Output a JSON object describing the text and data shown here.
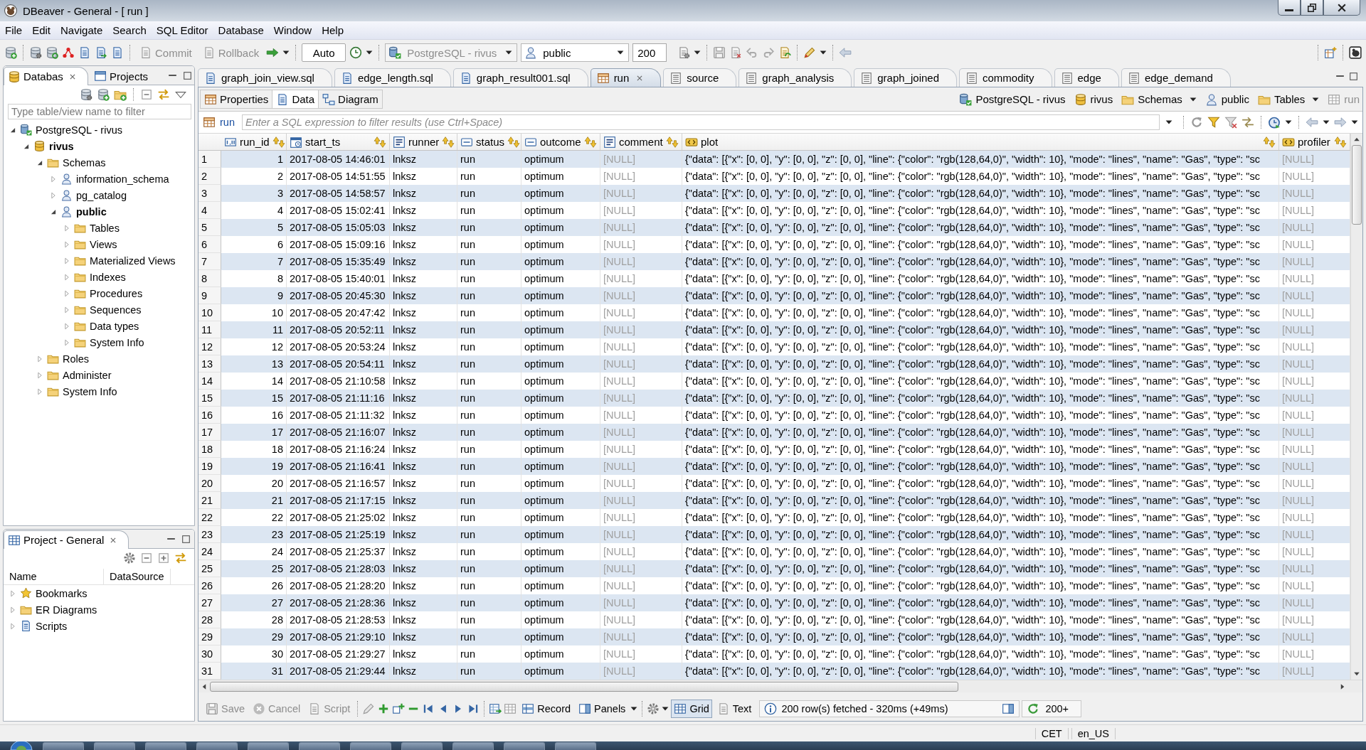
{
  "window": {
    "title": "DBeaver - General - [ run ]"
  },
  "menu": [
    "File",
    "Edit",
    "Navigate",
    "Search",
    "SQL Editor",
    "Database",
    "Window",
    "Help"
  ],
  "toolbar": {
    "transaction_buttons": [
      {
        "label": "Commit",
        "disabled": true
      },
      {
        "label": "Rollback",
        "disabled": true
      }
    ],
    "commit_mode": "Auto",
    "datasource": {
      "value": "PostgreSQL - rivus",
      "disabled": true
    },
    "schema": {
      "value": "public",
      "disabled": false
    },
    "result_limit": "200"
  },
  "navigator": {
    "tabs": [
      {
        "label": "Databas",
        "selected": true
      },
      {
        "label": "Projects",
        "selected": false
      }
    ],
    "filter": {
      "placeholder": "Type table/view name to filter"
    },
    "tree": [
      {
        "label": "PostgreSQL - rivus",
        "kind": "connection",
        "expanded": true,
        "bold": false,
        "children": [
          {
            "label": "rivus",
            "kind": "database",
            "expanded": true,
            "bold": true,
            "children": [
              {
                "label": "Schemas",
                "kind": "folder",
                "expanded": true,
                "bold": false,
                "children": [
                  {
                    "label": "information_schema",
                    "kind": "schema",
                    "expanded": false,
                    "bold": false
                  },
                  {
                    "label": "pg_catalog",
                    "kind": "schema",
                    "expanded": false,
                    "bold": false
                  },
                  {
                    "label": "public",
                    "kind": "schema",
                    "expanded": true,
                    "bold": true,
                    "children": [
                      {
                        "label": "Tables",
                        "kind": "folder",
                        "expanded": false,
                        "bold": false
                      },
                      {
                        "label": "Views",
                        "kind": "folder",
                        "expanded": false,
                        "bold": false
                      },
                      {
                        "label": "Materialized Views",
                        "kind": "folder",
                        "expanded": false,
                        "bold": false
                      },
                      {
                        "label": "Indexes",
                        "kind": "folder",
                        "expanded": false,
                        "bold": false
                      },
                      {
                        "label": "Procedures",
                        "kind": "folder",
                        "expanded": false,
                        "bold": false
                      },
                      {
                        "label": "Sequences",
                        "kind": "folder",
                        "expanded": false,
                        "bold": false
                      },
                      {
                        "label": "Data types",
                        "kind": "folder",
                        "expanded": false,
                        "bold": false
                      },
                      {
                        "label": "System Info",
                        "kind": "folder",
                        "expanded": false,
                        "bold": false
                      }
                    ]
                  }
                ]
              },
              {
                "label": "Roles",
                "kind": "folder",
                "expanded": false,
                "bold": false
              },
              {
                "label": "Administer",
                "kind": "folder",
                "expanded": false,
                "bold": false
              },
              {
                "label": "System Info",
                "kind": "folder",
                "expanded": false,
                "bold": false
              }
            ]
          }
        ]
      }
    ]
  },
  "project_panel": {
    "title": "Project - General",
    "columns": [
      "Name",
      "DataSource"
    ],
    "items": [
      {
        "label": "Bookmarks",
        "kind": "bookmarks",
        "expanded": false
      },
      {
        "label": "ER Diagrams",
        "kind": "diagrams",
        "expanded": false
      },
      {
        "label": "Scripts",
        "kind": "scripts",
        "expanded": false
      }
    ]
  },
  "editor_tabs": [
    {
      "label": "graph_join_view.sql",
      "kind": "script",
      "selected": false
    },
    {
      "label": "edge_length.sql",
      "kind": "script",
      "selected": false
    },
    {
      "label": "graph_result001.sql",
      "kind": "script",
      "selected": false
    },
    {
      "label": "run",
      "kind": "table",
      "selected": true
    },
    {
      "label": "source",
      "kind": "view",
      "selected": false
    },
    {
      "label": "graph_analysis",
      "kind": "view",
      "selected": false
    },
    {
      "label": "graph_joined",
      "kind": "view",
      "selected": false
    },
    {
      "label": "commodity",
      "kind": "view",
      "selected": false
    },
    {
      "label": "edge",
      "kind": "view",
      "selected": false
    },
    {
      "label": "edge_demand",
      "kind": "view",
      "selected": false
    }
  ],
  "view_tabs": [
    {
      "label": "Properties",
      "selected": false
    },
    {
      "label": "Data",
      "selected": true
    },
    {
      "label": "Diagram",
      "selected": false
    }
  ],
  "breadcrumb": [
    {
      "label": "PostgreSQL - rivus",
      "kind": "connection",
      "dropdown": false,
      "disabled": false
    },
    {
      "label": "rivus",
      "kind": "database",
      "dropdown": false,
      "disabled": false
    },
    {
      "label": "Schemas",
      "kind": "folder",
      "dropdown": true,
      "disabled": false
    },
    {
      "label": "public",
      "kind": "schema",
      "dropdown": false,
      "disabled": false
    },
    {
      "label": "Tables",
      "kind": "folder",
      "dropdown": true,
      "disabled": false
    },
    {
      "label": "run",
      "kind": "table",
      "dropdown": false,
      "disabled": true
    }
  ],
  "filter_bar": {
    "table": "run",
    "placeholder": "Enter a SQL expression to filter results (use Ctrl+Space)"
  },
  "table": {
    "columns": [
      {
        "name": "run_id",
        "kind": "numeric"
      },
      {
        "name": "start_ts",
        "kind": "timestamp"
      },
      {
        "name": "runner",
        "kind": "text"
      },
      {
        "name": "status",
        "kind": "string"
      },
      {
        "name": "outcome",
        "kind": "string"
      },
      {
        "name": "comment",
        "kind": "text"
      },
      {
        "name": "plot",
        "kind": "json"
      },
      {
        "name": "profiler",
        "kind": "json"
      }
    ],
    "rows": [
      {
        "number": "1",
        "cells": [
          {
            "text": "1",
            "null": false
          },
          {
            "text": "2017-08-05 14:46:01",
            "null": false
          },
          {
            "text": "lnksz",
            "null": false
          },
          {
            "text": "run",
            "null": false
          },
          {
            "text": "optimum",
            "null": false
          },
          {
            "text": "[NULL]",
            "null": true
          },
          {
            "text": "{\"data\": [{\"x\": [0, 0], \"y\": [0, 0], \"z\": [0, 0], \"line\": {\"color\": \"rgb(128,64,0)\", \"width\": 10}, \"mode\": \"lines\", \"name\": \"Gas\", \"type\": \"sc",
            "null": false
          },
          {
            "text": "[NULL]",
            "null": true
          }
        ]
      },
      {
        "number": "2",
        "cells": [
          {
            "text": "2",
            "null": false
          },
          {
            "text": "2017-08-05 14:51:55",
            "null": false
          },
          {
            "text": "lnksz",
            "null": false
          },
          {
            "text": "run",
            "null": false
          },
          {
            "text": "optimum",
            "null": false
          },
          {
            "text": "[NULL]",
            "null": true
          },
          {
            "text": "{\"data\": [{\"x\": [0, 0], \"y\": [0, 0], \"z\": [0, 0], \"line\": {\"color\": \"rgb(128,64,0)\", \"width\": 10}, \"mode\": \"lines\", \"name\": \"Gas\", \"type\": \"sc",
            "null": false
          },
          {
            "text": "[NULL]",
            "null": true
          }
        ]
      },
      {
        "number": "3",
        "cells": [
          {
            "text": "3",
            "null": false
          },
          {
            "text": "2017-08-05 14:58:57",
            "null": false
          },
          {
            "text": "lnksz",
            "null": false
          },
          {
            "text": "run",
            "null": false
          },
          {
            "text": "optimum",
            "null": false
          },
          {
            "text": "[NULL]",
            "null": true
          },
          {
            "text": "{\"data\": [{\"x\": [0, 0], \"y\": [0, 0], \"z\": [0, 0], \"line\": {\"color\": \"rgb(128,64,0)\", \"width\": 10}, \"mode\": \"lines\", \"name\": \"Gas\", \"type\": \"sc",
            "null": false
          },
          {
            "text": "[NULL]",
            "null": true
          }
        ]
      },
      {
        "number": "4",
        "cells": [
          {
            "text": "4",
            "null": false
          },
          {
            "text": "2017-08-05 15:02:41",
            "null": false
          },
          {
            "text": "lnksz",
            "null": false
          },
          {
            "text": "run",
            "null": false
          },
          {
            "text": "optimum",
            "null": false
          },
          {
            "text": "[NULL]",
            "null": true
          },
          {
            "text": "{\"data\": [{\"x\": [0, 0], \"y\": [0, 0], \"z\": [0, 0], \"line\": {\"color\": \"rgb(128,64,0)\", \"width\": 10}, \"mode\": \"lines\", \"name\": \"Gas\", \"type\": \"sc",
            "null": false
          },
          {
            "text": "[NULL]",
            "null": true
          }
        ]
      },
      {
        "number": "5",
        "cells": [
          {
            "text": "5",
            "null": false
          },
          {
            "text": "2017-08-05 15:05:03",
            "null": false
          },
          {
            "text": "lnksz",
            "null": false
          },
          {
            "text": "run",
            "null": false
          },
          {
            "text": "optimum",
            "null": false
          },
          {
            "text": "[NULL]",
            "null": true
          },
          {
            "text": "{\"data\": [{\"x\": [0, 0], \"y\": [0, 0], \"z\": [0, 0], \"line\": {\"color\": \"rgb(128,64,0)\", \"width\": 10}, \"mode\": \"lines\", \"name\": \"Gas\", \"type\": \"sc",
            "null": false
          },
          {
            "text": "[NULL]",
            "null": true
          }
        ]
      },
      {
        "number": "6",
        "cells": [
          {
            "text": "6",
            "null": false
          },
          {
            "text": "2017-08-05 15:09:16",
            "null": false
          },
          {
            "text": "lnksz",
            "null": false
          },
          {
            "text": "run",
            "null": false
          },
          {
            "text": "optimum",
            "null": false
          },
          {
            "text": "[NULL]",
            "null": true
          },
          {
            "text": "{\"data\": [{\"x\": [0, 0], \"y\": [0, 0], \"z\": [0, 0], \"line\": {\"color\": \"rgb(128,64,0)\", \"width\": 10}, \"mode\": \"lines\", \"name\": \"Gas\", \"type\": \"sc",
            "null": false
          },
          {
            "text": "[NULL]",
            "null": true
          }
        ]
      },
      {
        "number": "7",
        "cells": [
          {
            "text": "7",
            "null": false
          },
          {
            "text": "2017-08-05 15:35:49",
            "null": false
          },
          {
            "text": "lnksz",
            "null": false
          },
          {
            "text": "run",
            "null": false
          },
          {
            "text": "optimum",
            "null": false
          },
          {
            "text": "[NULL]",
            "null": true
          },
          {
            "text": "{\"data\": [{\"x\": [0, 0], \"y\": [0, 0], \"z\": [0, 0], \"line\": {\"color\": \"rgb(128,64,0)\", \"width\": 10}, \"mode\": \"lines\", \"name\": \"Gas\", \"type\": \"sc",
            "null": false
          },
          {
            "text": "[NULL]",
            "null": true
          }
        ]
      },
      {
        "number": "8",
        "cells": [
          {
            "text": "8",
            "null": false
          },
          {
            "text": "2017-08-05 15:40:01",
            "null": false
          },
          {
            "text": "lnksz",
            "null": false
          },
          {
            "text": "run",
            "null": false
          },
          {
            "text": "optimum",
            "null": false
          },
          {
            "text": "[NULL]",
            "null": true
          },
          {
            "text": "{\"data\": [{\"x\": [0, 0], \"y\": [0, 0], \"z\": [0, 0], \"line\": {\"color\": \"rgb(128,64,0)\", \"width\": 10}, \"mode\": \"lines\", \"name\": \"Gas\", \"type\": \"sc",
            "null": false
          },
          {
            "text": "[NULL]",
            "null": true
          }
        ]
      },
      {
        "number": "9",
        "cells": [
          {
            "text": "9",
            "null": false
          },
          {
            "text": "2017-08-05 20:45:30",
            "null": false
          },
          {
            "text": "lnksz",
            "null": false
          },
          {
            "text": "run",
            "null": false
          },
          {
            "text": "optimum",
            "null": false
          },
          {
            "text": "[NULL]",
            "null": true
          },
          {
            "text": "{\"data\": [{\"x\": [0, 0], \"y\": [0, 0], \"z\": [0, 0], \"line\": {\"color\": \"rgb(128,64,0)\", \"width\": 10}, \"mode\": \"lines\", \"name\": \"Gas\", \"type\": \"sc",
            "null": false
          },
          {
            "text": "[NULL]",
            "null": true
          }
        ]
      },
      {
        "number": "10",
        "cells": [
          {
            "text": "10",
            "null": false
          },
          {
            "text": "2017-08-05 20:47:42",
            "null": false
          },
          {
            "text": "lnksz",
            "null": false
          },
          {
            "text": "run",
            "null": false
          },
          {
            "text": "optimum",
            "null": false
          },
          {
            "text": "[NULL]",
            "null": true
          },
          {
            "text": "{\"data\": [{\"x\": [0, 0], \"y\": [0, 0], \"z\": [0, 0], \"line\": {\"color\": \"rgb(128,64,0)\", \"width\": 10}, \"mode\": \"lines\", \"name\": \"Gas\", \"type\": \"sc",
            "null": false
          },
          {
            "text": "[NULL]",
            "null": true
          }
        ]
      },
      {
        "number": "11",
        "cells": [
          {
            "text": "11",
            "null": false
          },
          {
            "text": "2017-08-05 20:52:11",
            "null": false
          },
          {
            "text": "lnksz",
            "null": false
          },
          {
            "text": "run",
            "null": false
          },
          {
            "text": "optimum",
            "null": false
          },
          {
            "text": "[NULL]",
            "null": true
          },
          {
            "text": "{\"data\": [{\"x\": [0, 0], \"y\": [0, 0], \"z\": [0, 0], \"line\": {\"color\": \"rgb(128,64,0)\", \"width\": 10}, \"mode\": \"lines\", \"name\": \"Gas\", \"type\": \"sc",
            "null": false
          },
          {
            "text": "[NULL]",
            "null": true
          }
        ]
      },
      {
        "number": "12",
        "cells": [
          {
            "text": "12",
            "null": false
          },
          {
            "text": "2017-08-05 20:53:24",
            "null": false
          },
          {
            "text": "lnksz",
            "null": false
          },
          {
            "text": "run",
            "null": false
          },
          {
            "text": "optimum",
            "null": false
          },
          {
            "text": "[NULL]",
            "null": true
          },
          {
            "text": "{\"data\": [{\"x\": [0, 0], \"y\": [0, 0], \"z\": [0, 0], \"line\": {\"color\": \"rgb(128,64,0)\", \"width\": 10}, \"mode\": \"lines\", \"name\": \"Gas\", \"type\": \"sc",
            "null": false
          },
          {
            "text": "[NULL]",
            "null": true
          }
        ]
      },
      {
        "number": "13",
        "cells": [
          {
            "text": "13",
            "null": false
          },
          {
            "text": "2017-08-05 20:54:11",
            "null": false
          },
          {
            "text": "lnksz",
            "null": false
          },
          {
            "text": "run",
            "null": false
          },
          {
            "text": "optimum",
            "null": false
          },
          {
            "text": "[NULL]",
            "null": true
          },
          {
            "text": "{\"data\": [{\"x\": [0, 0], \"y\": [0, 0], \"z\": [0, 0], \"line\": {\"color\": \"rgb(128,64,0)\", \"width\": 10}, \"mode\": \"lines\", \"name\": \"Gas\", \"type\": \"sc",
            "null": false
          },
          {
            "text": "[NULL]",
            "null": true
          }
        ]
      },
      {
        "number": "14",
        "cells": [
          {
            "text": "14",
            "null": false
          },
          {
            "text": "2017-08-05 21:10:58",
            "null": false
          },
          {
            "text": "lnksz",
            "null": false
          },
          {
            "text": "run",
            "null": false
          },
          {
            "text": "optimum",
            "null": false
          },
          {
            "text": "[NULL]",
            "null": true
          },
          {
            "text": "{\"data\": [{\"x\": [0, 0], \"y\": [0, 0], \"z\": [0, 0], \"line\": {\"color\": \"rgb(128,64,0)\", \"width\": 10}, \"mode\": \"lines\", \"name\": \"Gas\", \"type\": \"sc",
            "null": false
          },
          {
            "text": "[NULL]",
            "null": true
          }
        ]
      },
      {
        "number": "15",
        "cells": [
          {
            "text": "15",
            "null": false
          },
          {
            "text": "2017-08-05 21:11:16",
            "null": false
          },
          {
            "text": "lnksz",
            "null": false
          },
          {
            "text": "run",
            "null": false
          },
          {
            "text": "optimum",
            "null": false
          },
          {
            "text": "[NULL]",
            "null": true
          },
          {
            "text": "{\"data\": [{\"x\": [0, 0], \"y\": [0, 0], \"z\": [0, 0], \"line\": {\"color\": \"rgb(128,64,0)\", \"width\": 10}, \"mode\": \"lines\", \"name\": \"Gas\", \"type\": \"sc",
            "null": false
          },
          {
            "text": "[NULL]",
            "null": true
          }
        ]
      },
      {
        "number": "16",
        "cells": [
          {
            "text": "16",
            "null": false
          },
          {
            "text": "2017-08-05 21:11:32",
            "null": false
          },
          {
            "text": "lnksz",
            "null": false
          },
          {
            "text": "run",
            "null": false
          },
          {
            "text": "optimum",
            "null": false
          },
          {
            "text": "[NULL]",
            "null": true
          },
          {
            "text": "{\"data\": [{\"x\": [0, 0], \"y\": [0, 0], \"z\": [0, 0], \"line\": {\"color\": \"rgb(128,64,0)\", \"width\": 10}, \"mode\": \"lines\", \"name\": \"Gas\", \"type\": \"sc",
            "null": false
          },
          {
            "text": "[NULL]",
            "null": true
          }
        ]
      },
      {
        "number": "17",
        "cells": [
          {
            "text": "17",
            "null": false
          },
          {
            "text": "2017-08-05 21:16:07",
            "null": false
          },
          {
            "text": "lnksz",
            "null": false
          },
          {
            "text": "run",
            "null": false
          },
          {
            "text": "optimum",
            "null": false
          },
          {
            "text": "[NULL]",
            "null": true
          },
          {
            "text": "{\"data\": [{\"x\": [0, 0], \"y\": [0, 0], \"z\": [0, 0], \"line\": {\"color\": \"rgb(128,64,0)\", \"width\": 10}, \"mode\": \"lines\", \"name\": \"Gas\", \"type\": \"sc",
            "null": false
          },
          {
            "text": "[NULL]",
            "null": true
          }
        ]
      },
      {
        "number": "18",
        "cells": [
          {
            "text": "18",
            "null": false
          },
          {
            "text": "2017-08-05 21:16:24",
            "null": false
          },
          {
            "text": "lnksz",
            "null": false
          },
          {
            "text": "run",
            "null": false
          },
          {
            "text": "optimum",
            "null": false
          },
          {
            "text": "[NULL]",
            "null": true
          },
          {
            "text": "{\"data\": [{\"x\": [0, 0], \"y\": [0, 0], \"z\": [0, 0], \"line\": {\"color\": \"rgb(128,64,0)\", \"width\": 10}, \"mode\": \"lines\", \"name\": \"Gas\", \"type\": \"sc",
            "null": false
          },
          {
            "text": "[NULL]",
            "null": true
          }
        ]
      },
      {
        "number": "19",
        "cells": [
          {
            "text": "19",
            "null": false
          },
          {
            "text": "2017-08-05 21:16:41",
            "null": false
          },
          {
            "text": "lnksz",
            "null": false
          },
          {
            "text": "run",
            "null": false
          },
          {
            "text": "optimum",
            "null": false
          },
          {
            "text": "[NULL]",
            "null": true
          },
          {
            "text": "{\"data\": [{\"x\": [0, 0], \"y\": [0, 0], \"z\": [0, 0], \"line\": {\"color\": \"rgb(128,64,0)\", \"width\": 10}, \"mode\": \"lines\", \"name\": \"Gas\", \"type\": \"sc",
            "null": false
          },
          {
            "text": "[NULL]",
            "null": true
          }
        ]
      },
      {
        "number": "20",
        "cells": [
          {
            "text": "20",
            "null": false
          },
          {
            "text": "2017-08-05 21:16:57",
            "null": false
          },
          {
            "text": "lnksz",
            "null": false
          },
          {
            "text": "run",
            "null": false
          },
          {
            "text": "optimum",
            "null": false
          },
          {
            "text": "[NULL]",
            "null": true
          },
          {
            "text": "{\"data\": [{\"x\": [0, 0], \"y\": [0, 0], \"z\": [0, 0], \"line\": {\"color\": \"rgb(128,64,0)\", \"width\": 10}, \"mode\": \"lines\", \"name\": \"Gas\", \"type\": \"sc",
            "null": false
          },
          {
            "text": "[NULL]",
            "null": true
          }
        ]
      },
      {
        "number": "21",
        "cells": [
          {
            "text": "21",
            "null": false
          },
          {
            "text": "2017-08-05 21:17:15",
            "null": false
          },
          {
            "text": "lnksz",
            "null": false
          },
          {
            "text": "run",
            "null": false
          },
          {
            "text": "optimum",
            "null": false
          },
          {
            "text": "[NULL]",
            "null": true
          },
          {
            "text": "{\"data\": [{\"x\": [0, 0], \"y\": [0, 0], \"z\": [0, 0], \"line\": {\"color\": \"rgb(128,64,0)\", \"width\": 10}, \"mode\": \"lines\", \"name\": \"Gas\", \"type\": \"sc",
            "null": false
          },
          {
            "text": "[NULL]",
            "null": true
          }
        ]
      },
      {
        "number": "22",
        "cells": [
          {
            "text": "22",
            "null": false
          },
          {
            "text": "2017-08-05 21:25:02",
            "null": false
          },
          {
            "text": "lnksz",
            "null": false
          },
          {
            "text": "run",
            "null": false
          },
          {
            "text": "optimum",
            "null": false
          },
          {
            "text": "[NULL]",
            "null": true
          },
          {
            "text": "{\"data\": [{\"x\": [0, 0], \"y\": [0, 0], \"z\": [0, 0], \"line\": {\"color\": \"rgb(128,64,0)\", \"width\": 10}, \"mode\": \"lines\", \"name\": \"Gas\", \"type\": \"sc",
            "null": false
          },
          {
            "text": "[NULL]",
            "null": true
          }
        ]
      },
      {
        "number": "23",
        "cells": [
          {
            "text": "23",
            "null": false
          },
          {
            "text": "2017-08-05 21:25:19",
            "null": false
          },
          {
            "text": "lnksz",
            "null": false
          },
          {
            "text": "run",
            "null": false
          },
          {
            "text": "optimum",
            "null": false
          },
          {
            "text": "[NULL]",
            "null": true
          },
          {
            "text": "{\"data\": [{\"x\": [0, 0], \"y\": [0, 0], \"z\": [0, 0], \"line\": {\"color\": \"rgb(128,64,0)\", \"width\": 10}, \"mode\": \"lines\", \"name\": \"Gas\", \"type\": \"sc",
            "null": false
          },
          {
            "text": "[NULL]",
            "null": true
          }
        ]
      },
      {
        "number": "24",
        "cells": [
          {
            "text": "24",
            "null": false
          },
          {
            "text": "2017-08-05 21:25:37",
            "null": false
          },
          {
            "text": "lnksz",
            "null": false
          },
          {
            "text": "run",
            "null": false
          },
          {
            "text": "optimum",
            "null": false
          },
          {
            "text": "[NULL]",
            "null": true
          },
          {
            "text": "{\"data\": [{\"x\": [0, 0], \"y\": [0, 0], \"z\": [0, 0], \"line\": {\"color\": \"rgb(128,64,0)\", \"width\": 10}, \"mode\": \"lines\", \"name\": \"Gas\", \"type\": \"sc",
            "null": false
          },
          {
            "text": "[NULL]",
            "null": true
          }
        ]
      },
      {
        "number": "25",
        "cells": [
          {
            "text": "25",
            "null": false
          },
          {
            "text": "2017-08-05 21:28:03",
            "null": false
          },
          {
            "text": "lnksz",
            "null": false
          },
          {
            "text": "run",
            "null": false
          },
          {
            "text": "optimum",
            "null": false
          },
          {
            "text": "[NULL]",
            "null": true
          },
          {
            "text": "{\"data\": [{\"x\": [0, 0], \"y\": [0, 0], \"z\": [0, 0], \"line\": {\"color\": \"rgb(128,64,0)\", \"width\": 10}, \"mode\": \"lines\", \"name\": \"Gas\", \"type\": \"sc",
            "null": false
          },
          {
            "text": "[NULL]",
            "null": true
          }
        ]
      },
      {
        "number": "26",
        "cells": [
          {
            "text": "26",
            "null": false
          },
          {
            "text": "2017-08-05 21:28:20",
            "null": false
          },
          {
            "text": "lnksz",
            "null": false
          },
          {
            "text": "run",
            "null": false
          },
          {
            "text": "optimum",
            "null": false
          },
          {
            "text": "[NULL]",
            "null": true
          },
          {
            "text": "{\"data\": [{\"x\": [0, 0], \"y\": [0, 0], \"z\": [0, 0], \"line\": {\"color\": \"rgb(128,64,0)\", \"width\": 10}, \"mode\": \"lines\", \"name\": \"Gas\", \"type\": \"sc",
            "null": false
          },
          {
            "text": "[NULL]",
            "null": true
          }
        ]
      },
      {
        "number": "27",
        "cells": [
          {
            "text": "27",
            "null": false
          },
          {
            "text": "2017-08-05 21:28:36",
            "null": false
          },
          {
            "text": "lnksz",
            "null": false
          },
          {
            "text": "run",
            "null": false
          },
          {
            "text": "optimum",
            "null": false
          },
          {
            "text": "[NULL]",
            "null": true
          },
          {
            "text": "{\"data\": [{\"x\": [0, 0], \"y\": [0, 0], \"z\": [0, 0], \"line\": {\"color\": \"rgb(128,64,0)\", \"width\": 10}, \"mode\": \"lines\", \"name\": \"Gas\", \"type\": \"sc",
            "null": false
          },
          {
            "text": "[NULL]",
            "null": true
          }
        ]
      },
      {
        "number": "28",
        "cells": [
          {
            "text": "28",
            "null": false
          },
          {
            "text": "2017-08-05 21:28:53",
            "null": false
          },
          {
            "text": "lnksz",
            "null": false
          },
          {
            "text": "run",
            "null": false
          },
          {
            "text": "optimum",
            "null": false
          },
          {
            "text": "[NULL]",
            "null": true
          },
          {
            "text": "{\"data\": [{\"x\": [0, 0], \"y\": [0, 0], \"z\": [0, 0], \"line\": {\"color\": \"rgb(128,64,0)\", \"width\": 10}, \"mode\": \"lines\", \"name\": \"Gas\", \"type\": \"sc",
            "null": false
          },
          {
            "text": "[NULL]",
            "null": true
          }
        ]
      },
      {
        "number": "29",
        "cells": [
          {
            "text": "29",
            "null": false
          },
          {
            "text": "2017-08-05 21:29:10",
            "null": false
          },
          {
            "text": "lnksz",
            "null": false
          },
          {
            "text": "run",
            "null": false
          },
          {
            "text": "optimum",
            "null": false
          },
          {
            "text": "[NULL]",
            "null": true
          },
          {
            "text": "{\"data\": [{\"x\": [0, 0], \"y\": [0, 0], \"z\": [0, 0], \"line\": {\"color\": \"rgb(128,64,0)\", \"width\": 10}, \"mode\": \"lines\", \"name\": \"Gas\", \"type\": \"sc",
            "null": false
          },
          {
            "text": "[NULL]",
            "null": true
          }
        ]
      },
      {
        "number": "30",
        "cells": [
          {
            "text": "30",
            "null": false
          },
          {
            "text": "2017-08-05 21:29:27",
            "null": false
          },
          {
            "text": "lnksz",
            "null": false
          },
          {
            "text": "run",
            "null": false
          },
          {
            "text": "optimum",
            "null": false
          },
          {
            "text": "[NULL]",
            "null": true
          },
          {
            "text": "{\"data\": [{\"x\": [0, 0], \"y\": [0, 0], \"z\": [0, 0], \"line\": {\"color\": \"rgb(128,64,0)\", \"width\": 10}, \"mode\": \"lines\", \"name\": \"Gas\", \"type\": \"sc",
            "null": false
          },
          {
            "text": "[NULL]",
            "null": true
          }
        ]
      },
      {
        "number": "31",
        "cells": [
          {
            "text": "31",
            "null": false
          },
          {
            "text": "2017-08-05 21:29:44",
            "null": false
          },
          {
            "text": "lnksz",
            "null": false
          },
          {
            "text": "run",
            "null": false
          },
          {
            "text": "optimum",
            "null": false
          },
          {
            "text": "[NULL]",
            "null": true
          },
          {
            "text": "{\"data\": [{\"x\": [0, 0], \"y\": [0, 0], \"z\": [0, 0], \"line\": {\"color\": \"rgb(128,64,0)\", \"width\": 10}, \"mode\": \"lines\", \"name\": \"Gas\", \"type\": \"sc",
            "null": false
          },
          {
            "text": "[NULL]",
            "null": true
          }
        ]
      }
    ]
  },
  "results_toolbar": {
    "buttons": [
      {
        "label": "Save",
        "disabled": true
      },
      {
        "label": "Cancel",
        "disabled": true
      },
      {
        "label": "Script",
        "disabled": true
      }
    ],
    "record": "Record",
    "panels": "Panels",
    "views": [
      {
        "label": "Grid",
        "selected": true
      },
      {
        "label": "Text",
        "selected": false
      }
    ],
    "status": "200 row(s) fetched - 320ms (+49ms)",
    "fetch_more": "200+"
  },
  "status_bar": [
    "CET",
    "en_US"
  ]
}
